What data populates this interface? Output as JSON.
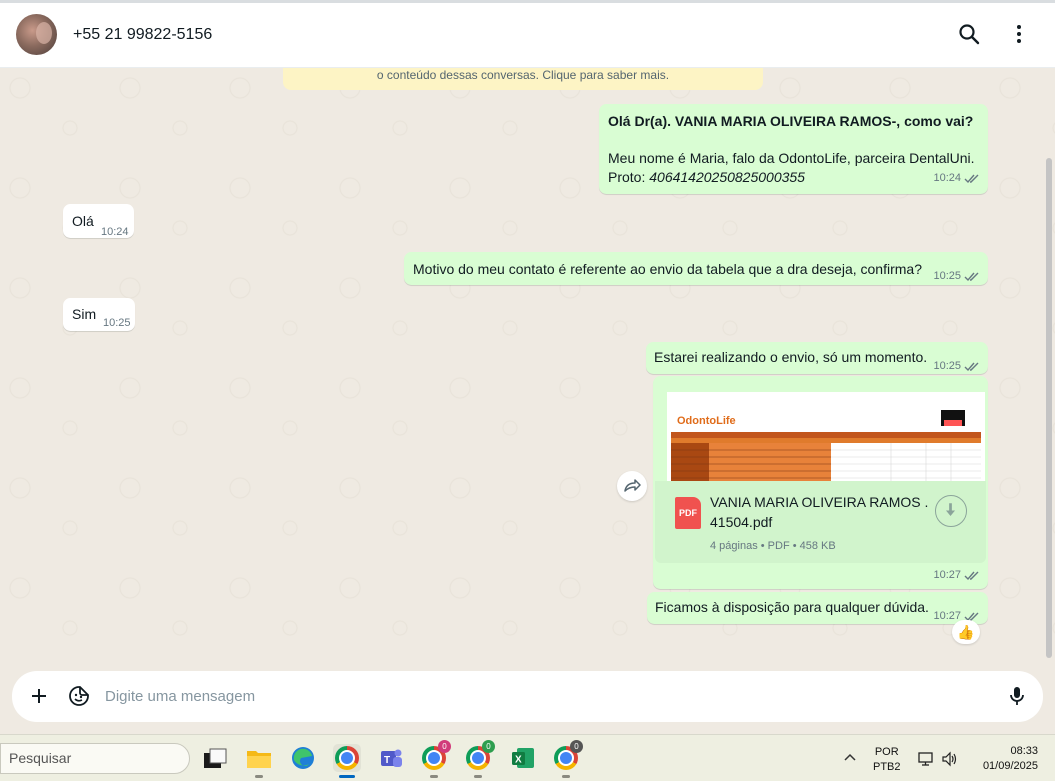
{
  "header": {
    "contact_name": "+55 21 99822-5156"
  },
  "encryption_banner": {
    "text": "o conteúdo dessas conversas. Clique para saber mais."
  },
  "messages": [
    {
      "direction": "out",
      "greeting": "Olá Dr(a). VANIA MARIA OLIVEIRA RAMOS-, como vai?",
      "body": "Meu nome é Maria, falo da OdontoLife, parceira DentalUni.",
      "proto_label": "Proto:",
      "proto_number": "40641420250825000355",
      "time": "10:24"
    },
    {
      "direction": "in",
      "text": "Olá",
      "time": "10:24"
    },
    {
      "direction": "out",
      "text": "Motivo do meu contato é referente ao envio da tabela que a dra deseja, confirma?",
      "time": "10:25"
    },
    {
      "direction": "in",
      "text": "Sim",
      "time": "10:25"
    },
    {
      "direction": "out",
      "text": "Estarei realizando o envio, só um momento.",
      "time": "10:25"
    },
    {
      "direction": "out",
      "type": "document",
      "preview_logo": "OdontoLife",
      "file_icon_label": "PDF",
      "file_name": "VANIA MARIA OLIVEIRA RAMOS . 41504.pdf",
      "file_meta": "4 páginas • PDF • 458 KB",
      "time": "10:27"
    },
    {
      "direction": "out",
      "text": "Ficamos à disposição para qualquer dúvida.",
      "time": "10:27",
      "reaction": "👍"
    }
  ],
  "composer": {
    "placeholder": "Digite uma mensagem"
  },
  "taskbar": {
    "search_placeholder": "Pesquisar",
    "chrome_badges": [
      "0",
      "0",
      "0"
    ],
    "language_top": "POR",
    "language_bottom": "PTB2",
    "time": "08:33",
    "date": "01/09/2025"
  },
  "icons": [
    "search-icon",
    "menu-icon",
    "forward-icon",
    "download-icon",
    "plus-icon",
    "sticker-icon",
    "mic-icon",
    "double-check-icon"
  ],
  "colors": {
    "outgoing_bubble": "#d9fdd3",
    "incoming_bubble": "#ffffff",
    "chat_background": "#efeae2",
    "banner": "#fdf4c5",
    "pdf_red": "#f0524f"
  }
}
